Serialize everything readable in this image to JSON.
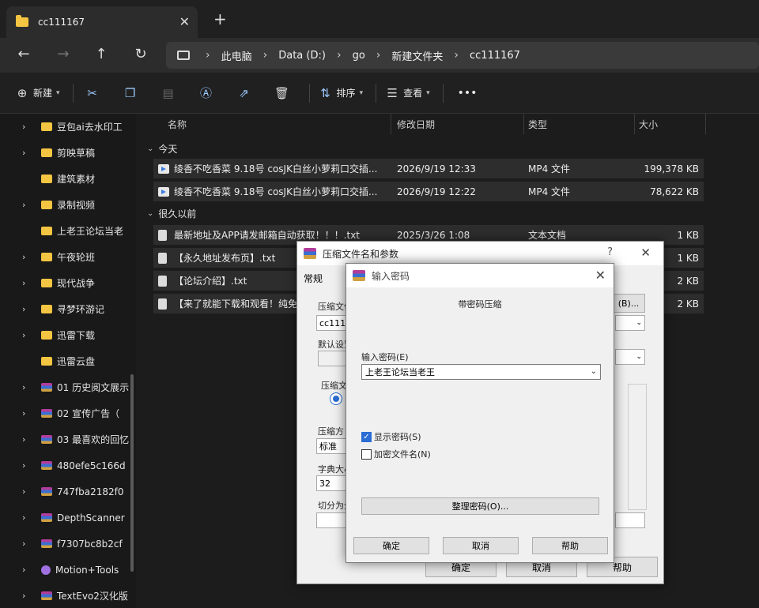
{
  "tab": {
    "title": "cc111167",
    "close": "✕",
    "new": "+"
  },
  "nav": {
    "back": "←",
    "forward": "→",
    "up": "↑",
    "refresh": "↻"
  },
  "breadcrumb": [
    "此电脑",
    "Data (D:)",
    "go",
    "新建文件夹",
    "cc111167"
  ],
  "toolbar": {
    "new_label": "新建",
    "sort_label": "排序",
    "view_label": "查看",
    "more": "•••"
  },
  "sidebar": {
    "items": [
      {
        "label": "豆包ai去水印工",
        "type": "folder",
        "chev": true
      },
      {
        "label": "剪映草稿",
        "type": "folder",
        "chev": true
      },
      {
        "label": "建筑素材",
        "type": "folder",
        "chev": false
      },
      {
        "label": "录制视频",
        "type": "folder",
        "chev": true
      },
      {
        "label": "上老王论坛当老",
        "type": "folder",
        "chev": false
      },
      {
        "label": "午夜轮班",
        "type": "folder",
        "chev": true
      },
      {
        "label": "现代战争",
        "type": "folder",
        "chev": true
      },
      {
        "label": "寻梦环游记",
        "type": "folder",
        "chev": true
      },
      {
        "label": "迅雷下载",
        "type": "folder",
        "chev": true
      },
      {
        "label": "迅雷云盘",
        "type": "folder",
        "chev": false
      },
      {
        "label": "01 历史阅文展示",
        "type": "rar",
        "chev": true
      },
      {
        "label": "02 宣传广告（",
        "type": "rar",
        "chev": true
      },
      {
        "label": "03 最喜欢的回忆",
        "type": "rar",
        "chev": true
      },
      {
        "label": "480efe5c166d",
        "type": "rar",
        "chev": true
      },
      {
        "label": "747fba2182f0",
        "type": "rar",
        "chev": true
      },
      {
        "label": "DepthScanner",
        "type": "rar",
        "chev": true
      },
      {
        "label": "f7307bc8b2cf",
        "type": "rar",
        "chev": true
      },
      {
        "label": "Motion+Tools",
        "type": "motion",
        "chev": true
      },
      {
        "label": "TextEvo2汉化版",
        "type": "rar",
        "chev": true
      }
    ]
  },
  "columns": {
    "name": "名称",
    "modified": "修改日期",
    "type": "类型",
    "size": "大小"
  },
  "groups": {
    "today": "今天",
    "long_ago": "很久以前"
  },
  "files_today": [
    {
      "name": "绫香不吃香菜 9.18号 cosJK白丝小萝莉口交插...",
      "date": "2026/9/19 12:33",
      "type": "MP4 文件",
      "size": "199,378 KB"
    },
    {
      "name": "绫香不吃香菜 9.18号 cosJK白丝小萝莉口交插...",
      "date": "2026/9/19 12:22",
      "type": "MP4 文件",
      "size": "78,622 KB"
    }
  ],
  "files_old": [
    {
      "name": "最新地址及APP请发邮箱自动获取！！！.txt",
      "date": "2025/3/26 1:08",
      "type": "文本文档",
      "size": "1 KB"
    },
    {
      "name": "【永久地址发布页】.txt",
      "date": "",
      "type": "",
      "size": "1 KB"
    },
    {
      "name": "【论坛介绍】.txt",
      "date": "",
      "type": "",
      "size": "2 KB"
    },
    {
      "name": "【来了就能下载和观看！纯免",
      "date": "",
      "type": "",
      "size": "2 KB"
    }
  ],
  "archive_dialog": {
    "title": "压缩文件名和参数",
    "help": "?",
    "close": "✕",
    "tab_general": "常规",
    "lbl_archive": "压缩文件",
    "archive_value": "cc1111",
    "browse": "(B)...",
    "lbl_default": "默认设置",
    "lbl_format": "压缩文",
    "lbl_method": "压缩方",
    "method_value": "标准",
    "lbl_dict": "字典大小",
    "dict_value": "32",
    "lbl_split": "切分为分",
    "ok": "确定",
    "cancel": "取消",
    "help_btn": "帮助"
  },
  "password_dialog": {
    "title": "输入密码",
    "close": "✕",
    "heading": "带密码压缩",
    "lbl_enter": "输入密码(E)",
    "password_value": "上老王论坛当老王",
    "show_password": "显示密码(S)",
    "encrypt_names": "加密文件名(N)",
    "organize": "整理密码(O)...",
    "ok": "确定",
    "cancel": "取消",
    "help": "帮助"
  }
}
